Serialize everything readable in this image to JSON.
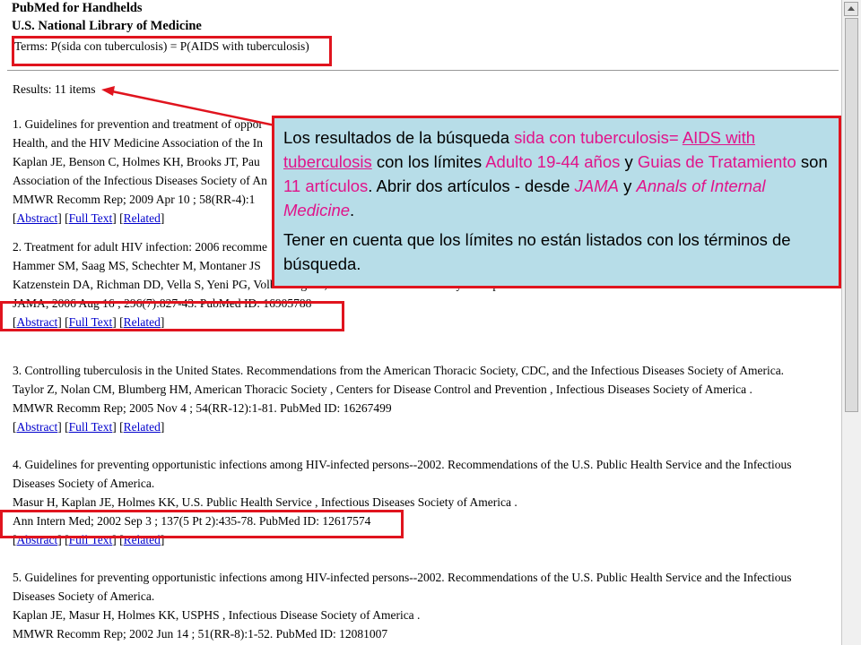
{
  "header": {
    "app_title": "PubMed for Handhelds",
    "org": "U.S. National Library of Medicine",
    "terms": "Terms: P(sida con tuberculosis) = P(AIDS with tuberculosis)"
  },
  "results_count": "Results: 11 items",
  "link_labels": {
    "abstract": "Abstract",
    "full_text": "Full Text",
    "related": "Related"
  },
  "items": [
    {
      "title": "1. Guidelines for prevention and treatment of oppor",
      "authors": "Health, and the HIV Medicine Association of the In",
      "authors2": "Kaplan JE, Benson C, Holmes KH, Brooks JT, Pau",
      "authors3": "Association of the Infectious Diseases Society of An",
      "citation": "MMWR Recomm Rep; 2009 Apr 10 ; 58(RR-4):1"
    },
    {
      "title": "2. Treatment for adult HIV infection: 2006 recomme",
      "authors": "Hammer SM, Saag MS, Schechter M, Montaner JS",
      "authors2": "Katzenstein DA, Richman DD, Vella S, Yeni PG, Volberding PA, International AIDS Society-USA panel .",
      "citation": "JAMA; 2006 Aug 16 ; 296(7):827-43. PubMed ID: 16905788"
    },
    {
      "title": "3. Controlling tuberculosis in the United States. Recommendations from the American Thoracic Society, CDC, and the Infectious Diseases Society of America.",
      "authors": "Taylor Z, Nolan CM, Blumberg HM, American Thoracic Society , Centers for Disease Control and Prevention , Infectious Diseases Society of America .",
      "citation": "MMWR Recomm Rep; 2005 Nov 4 ; 54(RR-12):1-81. PubMed ID: 16267499"
    },
    {
      "title": "4. Guidelines for preventing opportunistic infections among HIV-infected persons--2002. Recommendations of the U.S. Public Health Service and the Infectious",
      "title2": "Diseases Society of America.",
      "authors": "Masur H, Kaplan JE, Holmes KK, U.S. Public Health Service , Infectious Diseases Society of America .",
      "citation": "Ann Intern Med; 2002 Sep 3 ; 137(5 Pt 2):435-78. PubMed ID: 12617574"
    },
    {
      "title": "5. Guidelines for preventing opportunistic infections among HIV-infected persons--2002. Recommendations of the U.S. Public Health Service and the Infectious",
      "title2": "Diseases Society of America.",
      "authors": "Kaplan JE, Masur H, Holmes KK, USPHS , Infectious Disease Society of America .",
      "citation": "MMWR Recomm Rep; 2002 Jun 14 ; 51(RR-8):1-52. PubMed ID: 12081007"
    }
  ],
  "callout": {
    "p1_a": "Los resultados de la búsqueda ",
    "p1_hl1": "sida con tuberculosis= ",
    "p1_hl2": "AIDS with tuberculosis",
    "p1_b": " con los límites ",
    "p1_hl3": "Adulto 19-44 años",
    "p1_c": " y ",
    "p1_hl4": "Guias de Tratamiento",
    "p1_d": " son ",
    "p1_hl5": "11 artículos",
    "p1_e": ". Abrir dos artículos - desde ",
    "p1_hl6": "JAMA",
    "p1_f": " y ",
    "p1_hl7": "Annals of Internal Medicine",
    "p1_g": ".",
    "p2": "Tener en cuenta que los límites no están listados con los términos de búsqueda."
  },
  "colors": {
    "annotation_red": "#e0141e",
    "callout_bg": "#b7dde8",
    "highlight_pink": "#e0148a",
    "link_blue": "#0000cc"
  }
}
